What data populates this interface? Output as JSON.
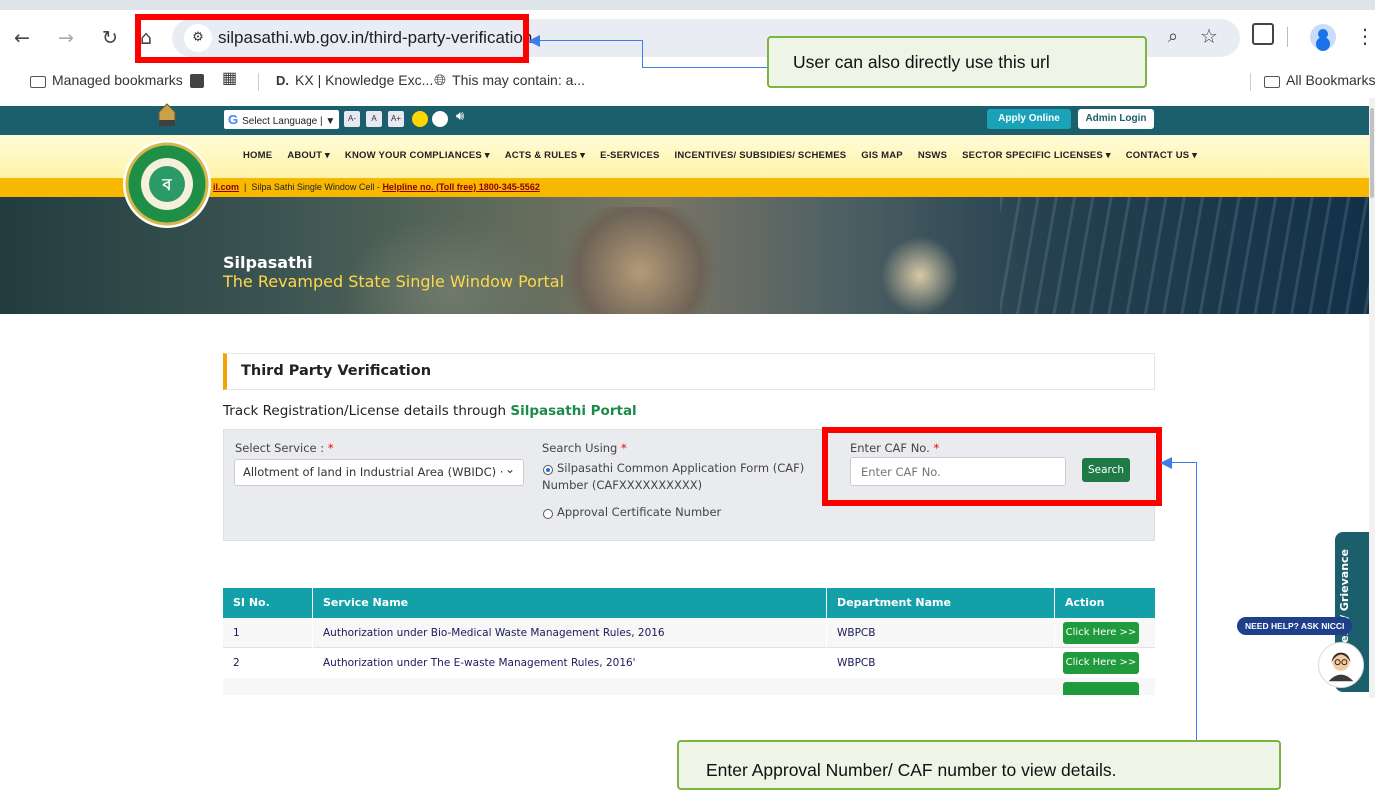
{
  "browser": {
    "url": "silpasathi.wb.gov.in/third-party-verification",
    "bookmarks": [
      {
        "label": "Managed bookmarks"
      },
      {
        "label": "KX | Knowledge Exc..."
      },
      {
        "label": "This may contain: a..."
      },
      {
        "label": "All Bookmarks"
      }
    ]
  },
  "annotations": {
    "url_callout": "User can also directly use this url",
    "caf_callout": "Enter Approval Number/ CAF number to view details."
  },
  "site": {
    "translate_label": "Select Language",
    "font_sizes": [
      "A-",
      "A",
      "A+"
    ],
    "apply_online": "Apply Online",
    "admin_login": "Admin Login",
    "menu": [
      "HOME",
      "ABOUT ▾",
      "KNOW YOUR COMPLIANCES ▾",
      "ACTS & RULES ▾",
      "E-SERVICES",
      "INCENTIVES/ SUBSIDIES/ SCHEMES",
      "GIS MAP",
      "NSWS",
      "SECTOR SPECIFIC LICENSES ▾",
      "CONTACT US ▾"
    ],
    "info_email_fragment": "il.com",
    "info_cell": "Silpa Sathi Single Window Cell -",
    "info_helpline": "Helpline no. (Toll free) 1800-345-5562",
    "banner_title": "Silpasathi",
    "banner_subtitle": "The Revamped State Single Window Portal"
  },
  "page": {
    "panel_title": "Third Party Verification",
    "track_prefix": "Track Registration/License details through",
    "track_portal": "Silpasathi Portal",
    "form": {
      "service_label": "Select Service :",
      "service_value": "Allotment of land in Industrial Area (WBIDC) ·",
      "search_using_label": "Search Using",
      "option_caf_line1": "Silpasathi Common Application Form (CAF)",
      "option_caf_line2": "Number (CAFXXXXXXXXXX)",
      "option_approval": "Approval Certificate Number",
      "caf_label": "Enter CAF No.",
      "caf_placeholder": "Enter CAF No.",
      "search_button": "Search",
      "required_mark": "*"
    },
    "table": {
      "headers": [
        "SI No.",
        "Service Name",
        "Department Name",
        "Action"
      ],
      "rows": [
        {
          "no": "1",
          "service": "Authorization under Bio-Medical Waste Management Rules, 2016",
          "dept": "WBPCB",
          "action": "Click Here >>"
        },
        {
          "no": "2",
          "service": "Authorization under The E-waste Management Rules, 2016'",
          "dept": "WBPCB",
          "action": "Click Here >>"
        }
      ]
    },
    "side_tab": "Query / Grievance",
    "need_help": "NEED HELP? ASK NICCI"
  },
  "colors": {
    "top_band": "#1c5f6c",
    "info_band": "#f8b800",
    "table_header": "#14a0a9",
    "action_button": "#1f9a3c",
    "annotation_red": "#ff0000",
    "callout_border": "#7cb342"
  }
}
